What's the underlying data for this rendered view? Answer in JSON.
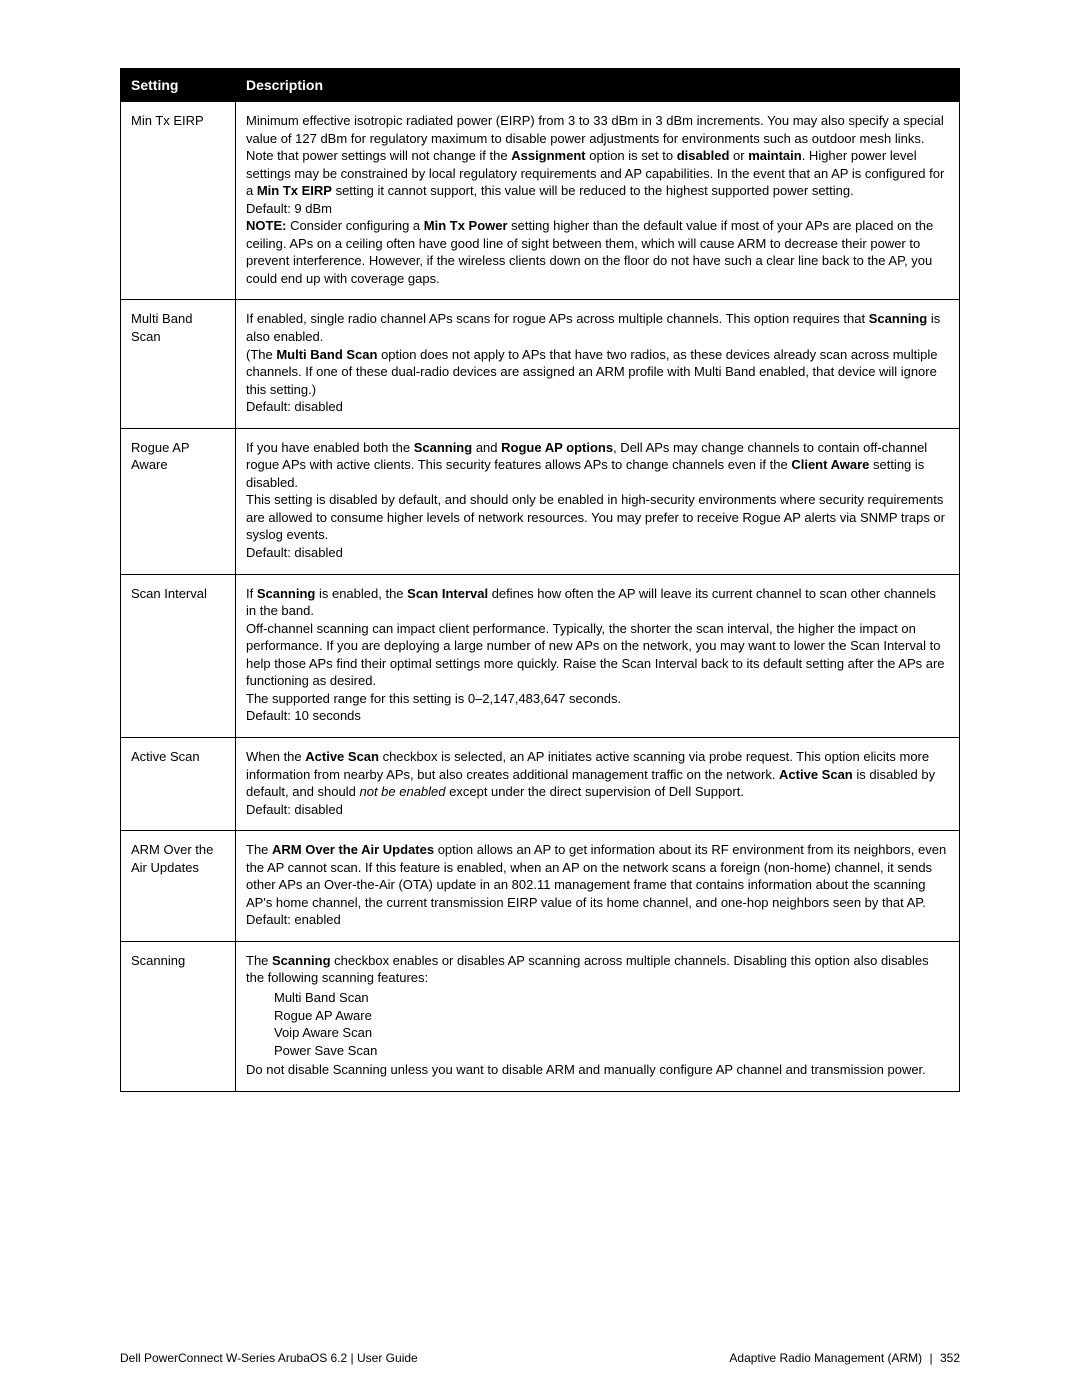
{
  "header": {
    "setting": "Setting",
    "description": "Description"
  },
  "rows": {
    "min_tx_eirp": {
      "setting": "Min Tx EIRP",
      "p1a": "Minimum effective isotropic radiated power (EIRP) from 3 to 33 dBm in 3 dBm increments. You may also specify a special value of 127 dBm for regulatory maximum to disable power adjustments for environments such as outdoor mesh links. Note that power settings will not change if the ",
      "bold_assignment": "Assignment",
      "p1b": " option is set to ",
      "bold_disabled": "disabled",
      "p1c": " or ",
      "bold_maintain": "maintain",
      "p1d": ". Higher power level settings may be constrained by local regulatory requirements and AP capabilities. In the event that an AP is configured for a ",
      "bold_mintxeirp": "Min Tx EIRP",
      "p1e": " setting it cannot support, this value will be reduced to the highest supported power setting.",
      "default": "Default: 9 dBm",
      "note_label": "NOTE:",
      "note_a": " Consider configuring a ",
      "bold_mintxpower": "Min Tx Power",
      "note_b": " setting higher than the default value if most of your APs are placed on the ceiling. APs on a ceiling often have good line of sight between them, which will cause ARM to decrease their power to prevent interference. However, if the wireless clients down on the floor do not have such a clear line back to the AP, you could end up with coverage gaps."
    },
    "multi_band_scan": {
      "setting": "Multi Band Scan",
      "p1a": "If enabled, single radio channel APs scans for rogue APs across multiple channels. This option requires that ",
      "bold_scanning": "Scanning",
      "p1b": " is also enabled.",
      "p2a": "(The ",
      "bold_mbs": "Multi Band Scan",
      "p2b": " option does not apply to APs that have two radios, as these devices already scan across multiple channels. If one of these dual-radio devices are assigned an ARM profile with Multi Band enabled, that device will ignore this setting.)",
      "default": "Default: disabled"
    },
    "rogue_ap_aware": {
      "setting": "Rogue AP Aware",
      "p1a": "If you have enabled both the ",
      "bold_scanning": "Scanning",
      "p1b": " and ",
      "bold_rogue": "Rogue AP options",
      "p1c": ", Dell APs may change channels to contain off-channel rogue APs with active clients. This security features allows APs to change channels even if the ",
      "bold_client_aware": "Client Aware",
      "p1d": " setting is disabled.",
      "p2": "This setting is disabled by default, and should only be enabled in high-security environments where security requirements are allowed to consume higher levels of network resources. You may prefer to receive Rogue AP alerts via SNMP traps or syslog events.",
      "default": "Default: disabled"
    },
    "scan_interval": {
      "setting": "Scan Interval",
      "p1a": "If ",
      "bold_scanning": "Scanning",
      "p1b": " is enabled, the ",
      "bold_scan_interval": "Scan Interval",
      "p1c": " defines how often the AP will leave its current channel to scan other channels in the band.",
      "p2": "Off-channel scanning can impact client performance. Typically, the shorter the scan interval, the higher the impact on performance. If you are deploying a large number of new APs on the network, you may want to lower the Scan Interval to help those APs find their optimal settings more quickly. Raise the Scan Interval back to its default setting after the APs are functioning as desired.",
      "p3": "The supported range for this setting is 0–2,147,483,647 seconds.",
      "default": "Default: 10 seconds"
    },
    "active_scan": {
      "setting": "Active Scan",
      "p1a": "When the ",
      "bold_active_scan": "Active Scan",
      "p1b": " checkbox is selected, an AP initiates active scanning via probe request. This option elicits more information from nearby APs, but also creates additional management traffic on the network. ",
      "bold_active_scan2": "Active Scan",
      "p1c": " is disabled by default, and should ",
      "italic_not": "not be enabled",
      "p1d": " except under the direct supervision of Dell Support.",
      "default": "Default: disabled"
    },
    "arm_ota": {
      "setting": "ARM Over the Air Updates",
      "p1a": "The ",
      "bold_arm_ota": "ARM Over the Air Updates",
      "p1b": " option allows an AP to get information about its RF environment from its neighbors, even the AP cannot scan. If this feature is enabled, when an AP on the network scans a foreign (non-home) channel, it sends other APs an Over-the-Air (OTA) update in an 802.11 management frame that contains information about the scanning AP's home channel, the current transmission EIRP value of its home channel, and one-hop neighbors seen by that AP.",
      "default": "Default: enabled"
    },
    "scanning": {
      "setting": "Scanning",
      "p1a": "The ",
      "bold_scanning": "Scanning",
      "p1b": " checkbox enables or disables AP scanning across multiple channels. Disabling this option also disables the following scanning features:",
      "feat1": "Multi Band Scan",
      "feat2": "Rogue AP Aware",
      "feat3": "Voip Aware Scan",
      "feat4": "Power Save Scan",
      "p2": "Do not disable Scanning unless you want to disable ARM and manually configure AP channel and transmission power."
    }
  },
  "footer": {
    "left": "Dell PowerConnect W-Series ArubaOS 6.2",
    "left_sep": " | ",
    "left2": "User Guide",
    "right": "Adaptive Radio Management (ARM)",
    "right_sep": " | ",
    "page": "352"
  }
}
